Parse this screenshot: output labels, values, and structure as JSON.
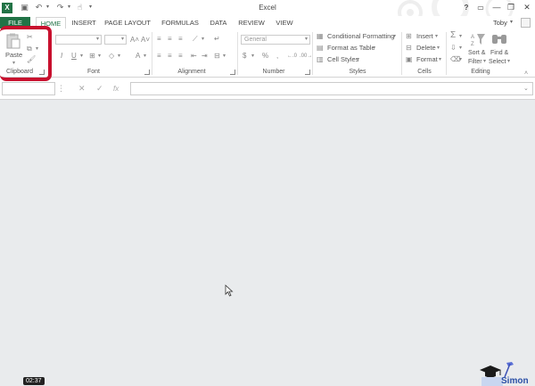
{
  "window": {
    "title": "Excel",
    "user": "Toby",
    "help": "?"
  },
  "tabs": [
    {
      "label": "FILE"
    },
    {
      "label": "HOME"
    },
    {
      "label": "INSERT"
    },
    {
      "label": "PAGE LAYOUT"
    },
    {
      "label": "FORMULAS"
    },
    {
      "label": "DATA"
    },
    {
      "label": "REVIEW"
    },
    {
      "label": "VIEW"
    }
  ],
  "ribbon": {
    "clipboard": {
      "label": "Clipboard",
      "paste": "Paste"
    },
    "font": {
      "label": "Font"
    },
    "alignment": {
      "label": "Alignment"
    },
    "number": {
      "label": "Number",
      "format": "General",
      "percent": "%",
      "comma": ","
    },
    "styles": {
      "label": "Styles",
      "conditional": "Conditional Formatting",
      "format_table": "Format as Table",
      "cell_styles": "Cell Styles"
    },
    "cells": {
      "label": "Cells",
      "insert": "Insert",
      "delete": "Delete",
      "format": "Format"
    },
    "editing": {
      "label": "Editing",
      "sort_filter_1": "Sort &",
      "sort_filter_2": "Filter",
      "find_select_1": "Find &",
      "find_select_2": "Select"
    }
  },
  "formula_bar": {
    "name_box": "",
    "value": ""
  },
  "overlay": {
    "timestamp": "02:37",
    "watermark": "Simon"
  },
  "colors": {
    "accent": "#217346",
    "highlight": "#c8102e"
  }
}
